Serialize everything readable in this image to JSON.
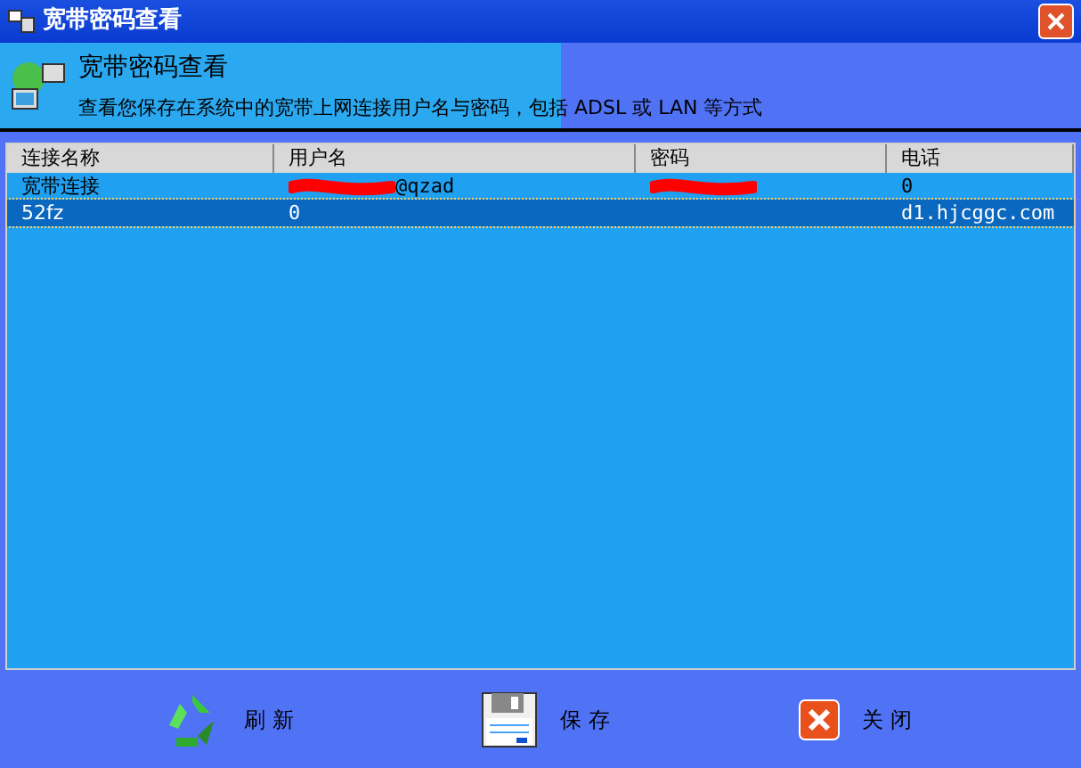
{
  "window": {
    "title": "宽带密码查看"
  },
  "header": {
    "title": "宽带密码查看",
    "description": "查看您保存在系统中的宽带上网连接用户名与密码，包括 ADSL 或 LAN 等方式"
  },
  "table": {
    "columns": [
      "连接名称",
      "用户名",
      "密码",
      "电话"
    ],
    "rows": [
      {
        "selected": false,
        "cells": [
          {
            "text": "宽带连接",
            "redacted": false
          },
          {
            "text": "@qzad",
            "redacted": true
          },
          {
            "redacted": true
          },
          {
            "text": "0",
            "redacted": false
          }
        ]
      },
      {
        "selected": true,
        "cells": [
          {
            "text": "52fz",
            "redacted": false
          },
          {
            "text": "0",
            "redacted": false
          },
          {
            "redacted": false
          },
          {
            "text": "d1.hjcggc.com",
            "redacted": false
          }
        ]
      }
    ]
  },
  "buttons": [
    {
      "kind": "refresh",
      "label": "刷新"
    },
    {
      "kind": "save",
      "label": "保存"
    },
    {
      "kind": "close",
      "label": "关闭"
    }
  ]
}
